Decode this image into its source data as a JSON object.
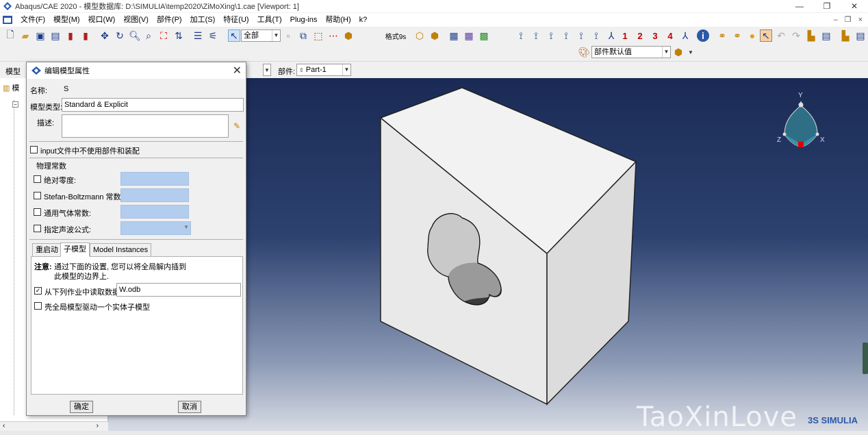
{
  "window": {
    "title": "Abaqus/CAE 2020 - 模型数据库: D:\\SIMULIA\\temp2020\\ZiMoXing\\1.cae [Viewport: 1]"
  },
  "menubar": {
    "items": [
      "文件(F)",
      "模型(M)",
      "视口(W)",
      "视图(V)",
      "部件(P)",
      "加工(S)",
      "特征(U)",
      "工具(T)",
      "Plug-ins",
      "帮助(H)"
    ],
    "help_cursor": "k?"
  },
  "toolbar": {
    "selection_filter": "全部",
    "render_style_label": "格式9s",
    "num1": "1",
    "num2": "2",
    "num3": "3",
    "num4": "4",
    "color_code": "部件默认值"
  },
  "context": {
    "module_label": "模型",
    "part_label": "部件:",
    "part_value": "Part-1"
  },
  "left_panel": {
    "tab": "模"
  },
  "dialog": {
    "title": "编辑模型属性",
    "name_label": "名称:",
    "name_value": "S",
    "model_type_label": "模型类型:",
    "model_type_value": "Standard & Explicit",
    "description_label": "描述:",
    "description_value": "",
    "no_parts_in_input": "input文件中不使用部件和装配",
    "physical_constants_group": "物理常数",
    "absolute_zero": "绝对零度:",
    "stefan_boltzmann": "Stefan-Boltzmann 常数:",
    "gas_constant": "通用气体常数:",
    "acoustic_wave": "指定声波公式:",
    "tabs": [
      "重启动",
      "子模型",
      "Model Instances"
    ],
    "note_label": "注意:",
    "note_line1": "通过下面的设置, 您可以将全局解内插到",
    "note_line2": "此模型的边界上.",
    "read_from_job_label": "从下列作业中读取数据:",
    "read_from_job_value": "W.odb",
    "read_from_job_checked": true,
    "shell_to_solid": "壳全局模型驱动一个实体子模型",
    "ok": "确定",
    "cancel": "取消"
  },
  "triad": {
    "x": "X",
    "y": "Y",
    "z": "Z"
  },
  "watermark": {
    "text": "TaoXinLove",
    "brand": "3S SIMULIA"
  }
}
